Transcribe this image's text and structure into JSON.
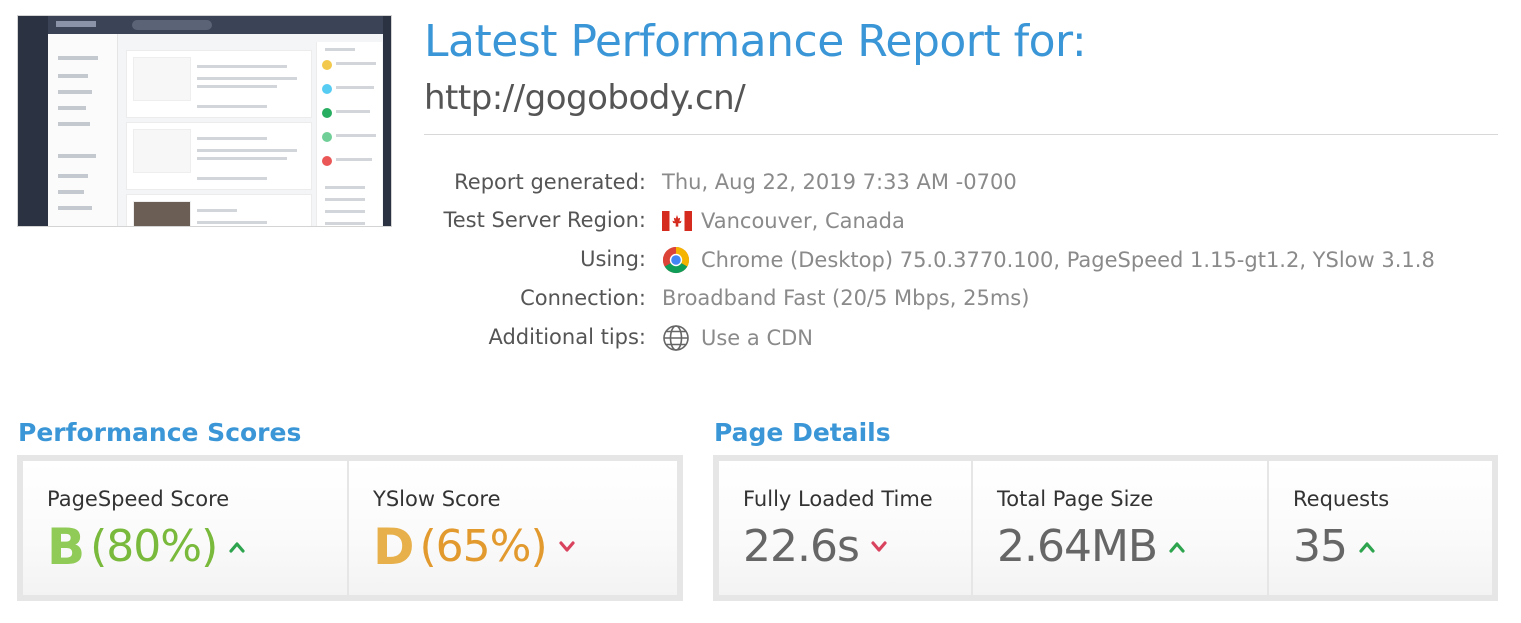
{
  "header": {
    "title": "Latest Performance Report for:",
    "url": "http://gogobody.cn/"
  },
  "info": [
    {
      "label": "Report generated:",
      "value": "Thu, Aug 22, 2019 7:33 AM -0700",
      "icon": ""
    },
    {
      "label": "Test Server Region:",
      "value": "Vancouver, Canada",
      "icon": "canada-flag-icon"
    },
    {
      "label": "Using:",
      "value": "Chrome (Desktop) 75.0.3770.100, PageSpeed 1.15-gt1.2, YSlow 3.1.8",
      "icon": "chrome-icon"
    },
    {
      "label": "Connection:",
      "value": "Broadband Fast (20/5 Mbps, 25ms)",
      "icon": ""
    },
    {
      "label": "Additional tips:",
      "value": "Use a CDN",
      "icon": "globe-icon"
    }
  ],
  "performance": {
    "title": "Performance Scores",
    "pagespeed": {
      "label": "PageSpeed Score",
      "grade": "B",
      "percent": "(80%)",
      "trend": "up",
      "color": "#79b93b"
    },
    "yslow": {
      "label": "YSlow Score",
      "grade": "D",
      "percent": "(65%)",
      "trend": "down",
      "color": "#e8a33a"
    }
  },
  "details": {
    "title": "Page Details",
    "load_time": {
      "label": "Fully Loaded Time",
      "value": "22.6s",
      "trend": "down"
    },
    "page_size": {
      "label": "Total Page Size",
      "value": "2.64MB",
      "trend": "up"
    },
    "requests": {
      "label": "Requests",
      "value": "35",
      "trend": "up"
    }
  },
  "colors": {
    "accent": "#3a96d6",
    "up": "#2ea44f",
    "down": "#d9435e"
  }
}
